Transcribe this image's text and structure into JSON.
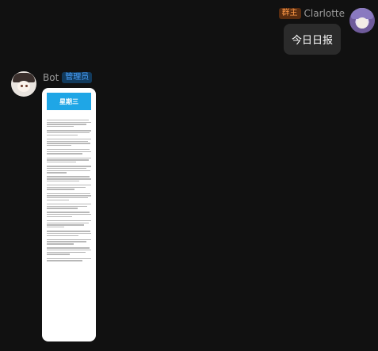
{
  "sender": {
    "badge": "群主",
    "name": "Clarlotte",
    "message": "今日日报"
  },
  "bot": {
    "name": "Bot",
    "badge": "管理员",
    "card": {
      "title": "星期三"
    }
  },
  "colors": {
    "background": "#111111",
    "bubble": "#2b2b2b",
    "owner_badge": "#ff9a48",
    "admin_badge": "#4aa3ff",
    "banner": "#1fa6e6"
  }
}
